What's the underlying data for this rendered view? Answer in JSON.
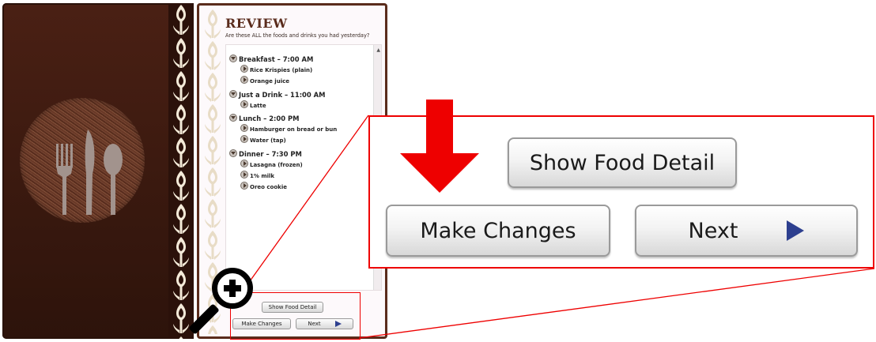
{
  "review": {
    "title": "REVIEW",
    "subtitle": "Are these ALL the foods and drinks you had yesterday?"
  },
  "meals": [
    {
      "label": "Breakfast – 7:00 AM",
      "foods": [
        "Rice Krispies (plain)",
        "Orange juice"
      ]
    },
    {
      "label": "Just a Drink  – 11:00 AM",
      "foods": [
        "Latte"
      ]
    },
    {
      "label": "Lunch – 2:00 PM",
      "foods": [
        "Hamburger on bread or bun",
        "Water (tap)"
      ]
    },
    {
      "label": "Dinner – 7:30 PM",
      "foods": [
        "Lasagna (frozen)",
        "1% milk",
        "Oreo cookie"
      ]
    }
  ],
  "buttons": {
    "show_food_detail": "Show Food Detail",
    "make_changes": "Make Changes",
    "next": "Next"
  },
  "colors": {
    "cover_brown": "#3a190f",
    "page_border": "#5a2c1c",
    "highlight_red": "#ee0000",
    "next_arrow_blue": "#2d3f8f"
  },
  "icons": {
    "expand": "triangle-down-circle",
    "item": "triangle-right-circle",
    "zoom": "magnifier-plus",
    "pointer": "down-arrow"
  }
}
